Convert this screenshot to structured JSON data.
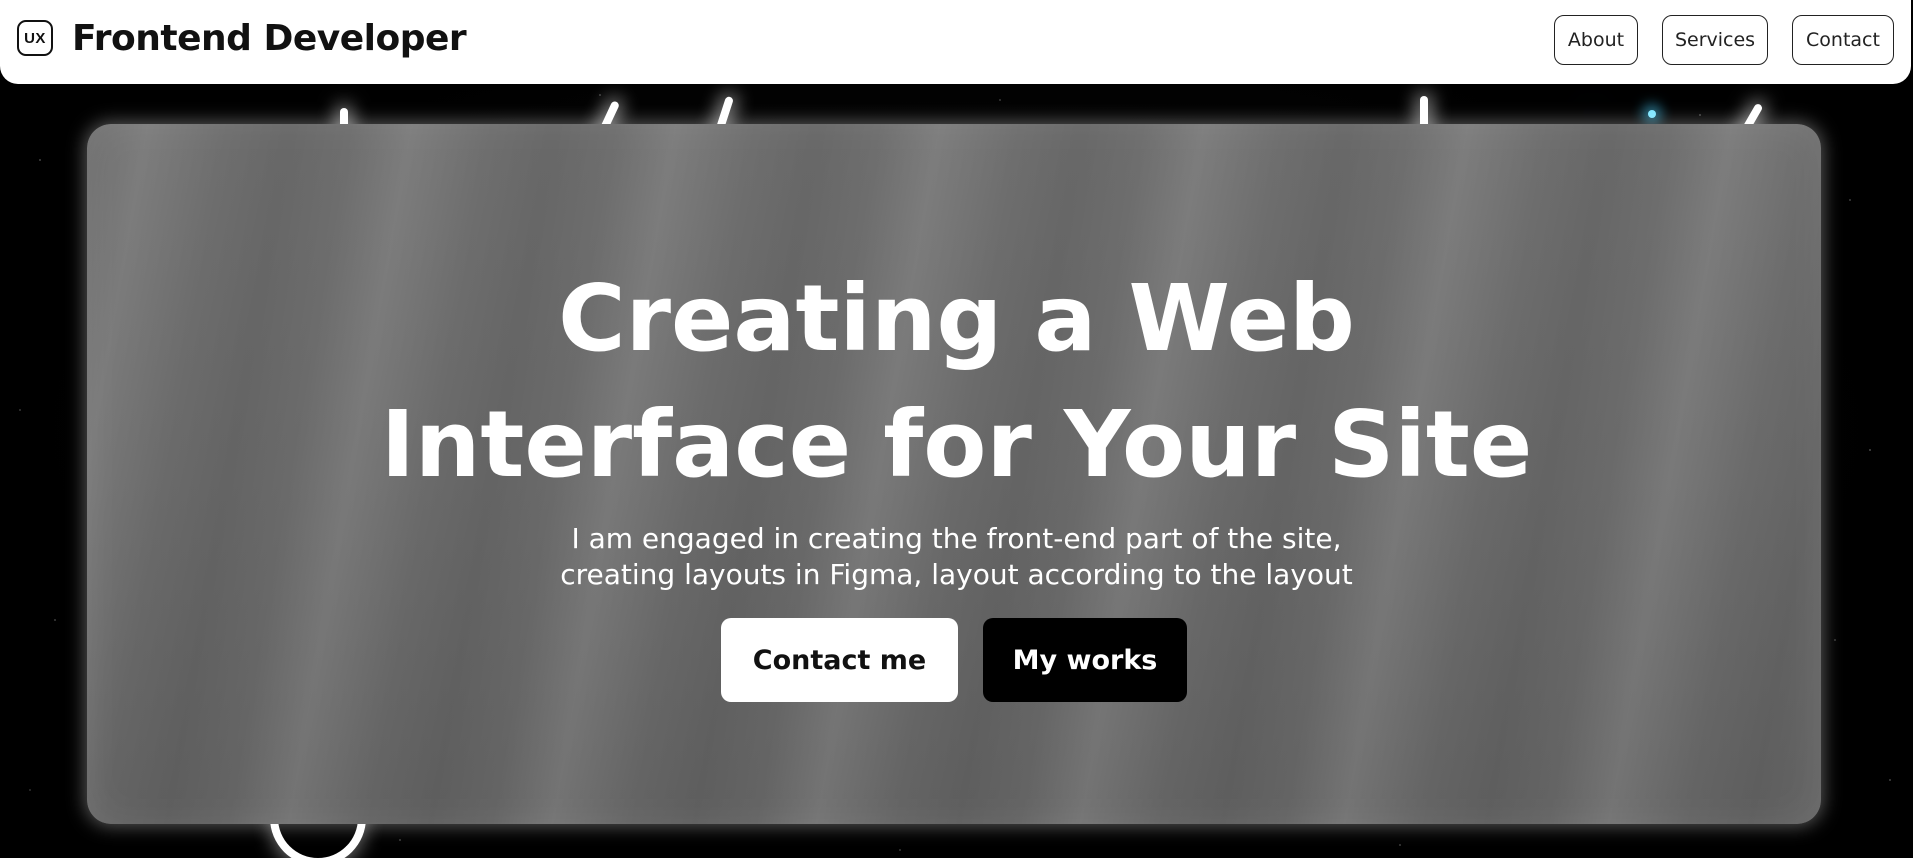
{
  "header": {
    "logo_text": "UX",
    "title": "Frontend Developer",
    "nav": [
      {
        "label": "About"
      },
      {
        "label": "Services"
      },
      {
        "label": "Contact"
      }
    ]
  },
  "hero": {
    "title_line1": "Creating a Web",
    "title_line2": "Interface for Your Site",
    "subtitle_line1": "I am engaged in creating the front-end part of the site,",
    "subtitle_line2": "creating layouts in Figma, layout according to the layout",
    "primary_button": "Contact me",
    "secondary_button": "My works"
  },
  "colors": {
    "background": "#000000",
    "header_bg": "#ffffff",
    "card_bg": "#6a6a6a",
    "accent_star": "#7fe6ff"
  }
}
